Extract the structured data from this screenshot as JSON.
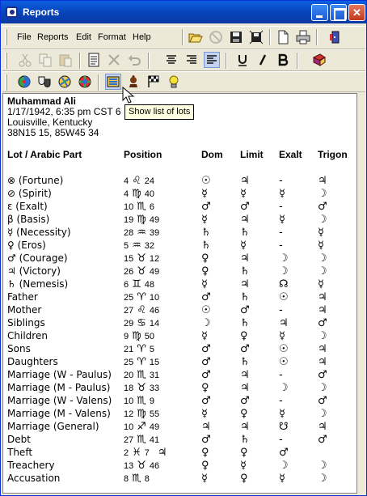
{
  "window": {
    "title": "Reports"
  },
  "menu": [
    "File",
    "Reports",
    "Edit",
    "Format",
    "Help"
  ],
  "toolbar_icons": [
    "open-folder-icon",
    "stop-icon",
    "save-icon",
    "save-as-icon",
    "new-page-icon",
    "print-icon",
    "exit-icon"
  ],
  "format_icons": [
    "cut-icon",
    "copy-icon",
    "paste-icon",
    "notes-icon",
    "delete-icon",
    "undo-icon",
    "align-center-icon",
    "align-right-icon",
    "align-left-icon",
    "underline-icon",
    "italic-icon",
    "bold-icon",
    "book-icon"
  ],
  "report_icons": [
    "wheel-icon",
    "masks-icon",
    "aspects-icon",
    "midpoints-icon",
    "lots-icon",
    "king-icon",
    "flags-icon",
    "lamp-icon"
  ],
  "tooltip": "Show list of lots",
  "chart_header": {
    "name": "Muhammad Ali",
    "datetime": "1/17/1942, 6:35 pm CST 6",
    "place": "Louisville, Kentucky",
    "coords": "38N15 15, 85W45 34"
  },
  "columns": [
    "Lot / Arabic Part",
    "Position",
    "Dom",
    "Limit",
    "Exalt",
    "Trigon"
  ],
  "rows": [
    {
      "name": "⊗ (Fortune)",
      "deg": "4",
      "sign": "♌",
      "min": "24",
      "dom": "☉",
      "lim": "♃",
      "ex": "-",
      "tri": "♃"
    },
    {
      "name": "⊘ (Spirit)",
      "deg": "4",
      "sign": "♍",
      "min": "40",
      "dom": "☿",
      "lim": "☿",
      "ex": "☿",
      "tri": "☽"
    },
    {
      "name": "ε (Exalt)",
      "deg": "10",
      "sign": "♏",
      "min": "6",
      "dom": "♂",
      "lim": "♂",
      "ex": "-",
      "tri": "♂"
    },
    {
      "name": "β (Basis)",
      "deg": "19",
      "sign": "♍",
      "min": "49",
      "dom": "☿",
      "lim": "♃",
      "ex": "☿",
      "tri": "☽"
    },
    {
      "name": "☿ (Necessity)",
      "deg": "28",
      "sign": "♒",
      "min": "39",
      "dom": "♄",
      "lim": "♄",
      "ex": "-",
      "tri": "☿"
    },
    {
      "name": "♀ (Eros)",
      "deg": "5",
      "sign": "♒",
      "min": "32",
      "dom": "♄",
      "lim": "☿",
      "ex": "-",
      "tri": "☿"
    },
    {
      "name": "♂ (Courage)",
      "deg": "15",
      "sign": "♉",
      "min": "12",
      "dom": "♀",
      "lim": "♃",
      "ex": "☽",
      "tri": "☽"
    },
    {
      "name": "♃ (Victory)",
      "deg": "26",
      "sign": "♉",
      "min": "49",
      "dom": "♀",
      "lim": "♄",
      "ex": "☽",
      "tri": "☽"
    },
    {
      "name": "♄ (Nemesis)",
      "deg": "6",
      "sign": "♊",
      "min": "48",
      "dom": "☿",
      "lim": "♃",
      "ex": "☊",
      "tri": "☿"
    },
    {
      "name": "Father",
      "deg": "25",
      "sign": "♈",
      "min": "10",
      "dom": "♂",
      "lim": "♄",
      "ex": "☉",
      "tri": "♃"
    },
    {
      "name": "Mother",
      "deg": "27",
      "sign": "♌",
      "min": "46",
      "dom": "☉",
      "lim": "♂",
      "ex": "-",
      "tri": "♃"
    },
    {
      "name": "Siblings",
      "deg": "29",
      "sign": "♋",
      "min": "14",
      "dom": "☽",
      "lim": "♄",
      "ex": "♃",
      "tri": "♂"
    },
    {
      "name": "Children",
      "deg": "9",
      "sign": "♍",
      "min": "50",
      "dom": "☿",
      "lim": "♀",
      "ex": "☿",
      "tri": "☽"
    },
    {
      "name": "Sons",
      "deg": "21",
      "sign": "♈",
      "min": "5",
      "dom": "♂",
      "lim": "♂",
      "ex": "☉",
      "tri": "♃"
    },
    {
      "name": "Daughters",
      "deg": "25",
      "sign": "♈",
      "min": "15",
      "dom": "♂",
      "lim": "♄",
      "ex": "☉",
      "tri": "♃"
    },
    {
      "name": "Marriage (W - Paulus)",
      "deg": "20",
      "sign": "♏",
      "min": "31",
      "dom": "♂",
      "lim": "♃",
      "ex": "-",
      "tri": "♂"
    },
    {
      "name": "Marriage (M - Paulus)",
      "deg": "18",
      "sign": "♉",
      "min": "33",
      "dom": "♀",
      "lim": "♃",
      "ex": "☽",
      "tri": "☽"
    },
    {
      "name": "Marriage (W - Valens)",
      "deg": "10",
      "sign": "♏",
      "min": "9",
      "dom": "♂",
      "lim": "♂",
      "ex": "-",
      "tri": "♂"
    },
    {
      "name": "Marriage (M - Valens)",
      "deg": "12",
      "sign": "♍",
      "min": "55",
      "dom": "☿",
      "lim": "♀",
      "ex": "☿",
      "tri": "☽"
    },
    {
      "name": "Marriage (General)",
      "deg": "10",
      "sign": "♐",
      "min": "49",
      "dom": "♃",
      "lim": "♃",
      "ex": "☋",
      "tri": "♃"
    },
    {
      "name": "Debt",
      "deg": "27",
      "sign": "♏",
      "min": "41",
      "dom": "♂",
      "lim": "♄",
      "ex": "-",
      "tri": "♂"
    },
    {
      "name": "Theft",
      "deg": "2",
      "sign": "♓",
      "min": "7",
      "extra": "♃",
      "dom": "♀",
      "lim": "♀",
      "ex": "♂",
      "tri": ""
    },
    {
      "name": "Treachery",
      "deg": "13",
      "sign": "♉",
      "min": "46",
      "dom": "♀",
      "lim": "☿",
      "ex": "☽",
      "tri": "☽"
    },
    {
      "name": "Accusation",
      "deg": "8",
      "sign": "♏",
      "min": "8",
      "dom": "☿",
      "lim": "♀",
      "ex": "☿",
      "tri": "☽"
    }
  ]
}
